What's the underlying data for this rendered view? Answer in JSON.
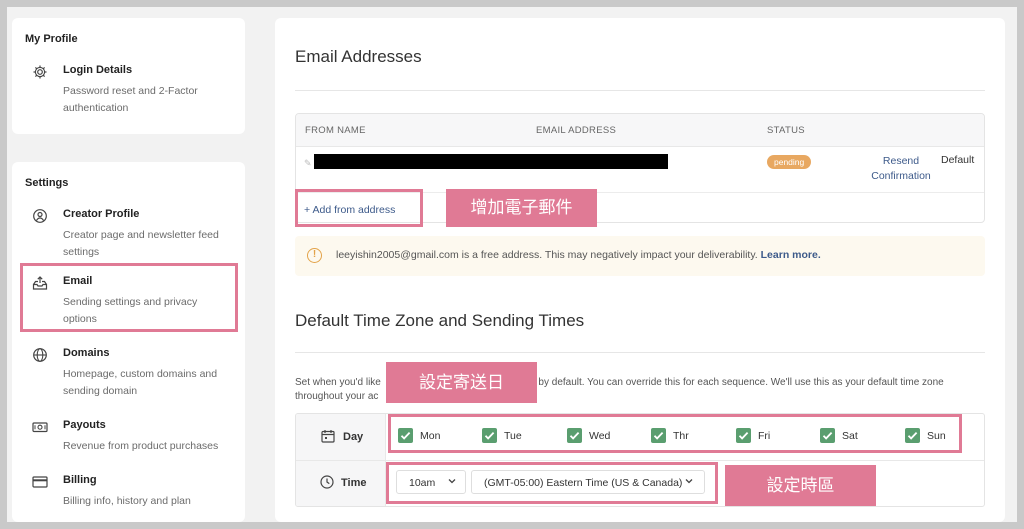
{
  "sidebar": {
    "profile_section": "My Profile",
    "settings_section": "Settings",
    "items": [
      {
        "label": "Login Details",
        "desc": "Password reset and 2-Factor authentication"
      },
      {
        "label": "Creator Profile",
        "desc": "Creator page and newsletter feed settings"
      },
      {
        "label": "Email",
        "desc": "Sending settings and privacy options"
      },
      {
        "label": "Domains",
        "desc": "Homepage, custom domains and sending domain"
      },
      {
        "label": "Payouts",
        "desc": "Revenue from product purchases"
      },
      {
        "label": "Billing",
        "desc": "Billing info, history and plan"
      }
    ]
  },
  "main": {
    "email_title": "Email Addresses",
    "table": {
      "headers": [
        "FROM NAME",
        "EMAIL ADDRESS",
        "STATUS"
      ],
      "row": {
        "status": "pending",
        "resend": "Resend Confirmation",
        "default": "Default"
      },
      "add_label": "+ Add from address"
    },
    "alert": {
      "text": "leeyishin2005@gmail.com is a free address. This may negatively impact your deliverability.",
      "link": "Learn more."
    },
    "tz_title": "Default Time Zone and Sending Times",
    "paragraph_a": "Set when you'd like",
    "paragraph_b": "t by default. You can override this for each sequence. We'll use this as your default time zone",
    "paragraph_c": "throughout your ac",
    "day_label": "Day",
    "time_label": "Time",
    "days": [
      "Mon",
      "Tue",
      "Wed",
      "Thr",
      "Fri",
      "Sat",
      "Sun"
    ],
    "time_value": "10am",
    "timezone_value": "(GMT-05:00) Eastern Time (US & Canada)"
  },
  "annotations": {
    "add_email": "增加電子郵件",
    "set_days": "設定寄送日",
    "set_timezone": "設定時區"
  },
  "colors": {
    "highlight": "#e07a95",
    "checkbox": "#5a9e6f",
    "badge": "#e8a861",
    "link": "#3d5a8a"
  }
}
